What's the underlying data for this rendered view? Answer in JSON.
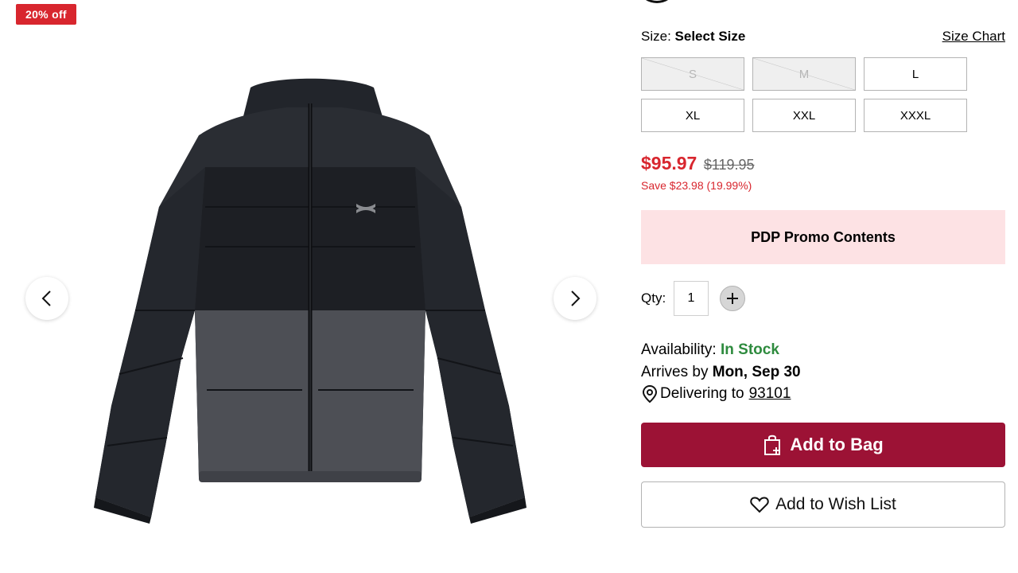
{
  "badge": {
    "text": "20% off",
    "color": "#d8262e"
  },
  "gallery": {
    "image": "black-gray-puffer-jacket",
    "prev_icon": "chevron-left-icon",
    "next_icon": "chevron-right-icon"
  },
  "size": {
    "label": "Size:",
    "selected_text": "Select Size",
    "chart_link": "Size Chart",
    "options": [
      {
        "label": "S",
        "available": false
      },
      {
        "label": "M",
        "available": false
      },
      {
        "label": "L",
        "available": true
      },
      {
        "label": "XL",
        "available": true
      },
      {
        "label": "XXL",
        "available": true
      },
      {
        "label": "XXXL",
        "available": true
      }
    ]
  },
  "price": {
    "current": "$95.97",
    "original": "$119.95",
    "savings": "Save $23.98 (19.99%)"
  },
  "promo": {
    "text": "PDP Promo Contents"
  },
  "quantity": {
    "label": "Qty:",
    "value": "1",
    "plus_icon": "plus-icon"
  },
  "availability": {
    "label": "Availability:",
    "status": "In Stock",
    "arrives_label": "Arrives by",
    "arrives_date": "Mon, Sep 30",
    "delivering_label": "Delivering to",
    "zip": "93101"
  },
  "buttons": {
    "add_to_bag": "Add to Bag",
    "wishlist": "Add to Wish List"
  },
  "colors": {
    "accent_red": "#d8262e",
    "add_to_bag_bg": "#9c1235",
    "in_stock_green": "#2e8b3e",
    "promo_bg": "#fde2e4"
  }
}
